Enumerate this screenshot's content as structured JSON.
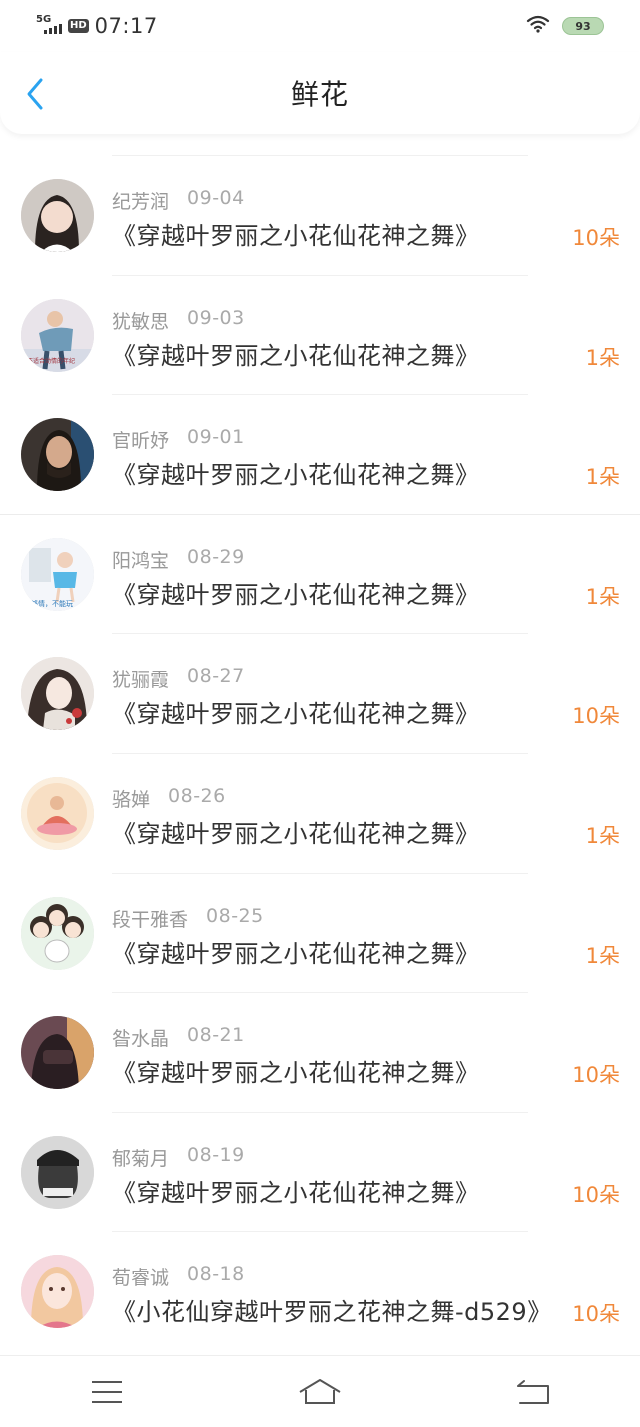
{
  "status_bar": {
    "network": "5G",
    "hd": "HD",
    "time": "07:17",
    "battery": "93"
  },
  "header": {
    "title": "鲜花"
  },
  "colors": {
    "accent_orange": "#f0883a",
    "back_blue": "#2aa3f0"
  },
  "records": [
    {
      "name": "纪芳润",
      "date": "09-04",
      "book": "《穿越叶罗丽之小花仙花神之舞》",
      "count": "10朵"
    },
    {
      "name": "犹敏思",
      "date": "09-03",
      "book": "《穿越叶罗丽之小花仙花神之舞》",
      "count": "1朵"
    },
    {
      "name": "官昕妤",
      "date": "09-01",
      "book": "《穿越叶罗丽之小花仙花神之舞》",
      "count": "1朵"
    },
    {
      "name": "阳鸿宝",
      "date": "08-29",
      "book": "《穿越叶罗丽之小花仙花神之舞》",
      "count": "1朵"
    },
    {
      "name": "犹骊霞",
      "date": "08-27",
      "book": "《穿越叶罗丽之小花仙花神之舞》",
      "count": "10朵"
    },
    {
      "name": "骆婵",
      "date": "08-26",
      "book": "《穿越叶罗丽之小花仙花神之舞》",
      "count": "1朵"
    },
    {
      "name": "段干雅香",
      "date": "08-25",
      "book": "《穿越叶罗丽之小花仙花神之舞》",
      "count": "1朵"
    },
    {
      "name": "昝水晶",
      "date": "08-21",
      "book": "《穿越叶罗丽之小花仙花神之舞》",
      "count": "10朵"
    },
    {
      "name": "郁菊月",
      "date": "08-19",
      "book": "《穿越叶罗丽之小花仙花神之舞》",
      "count": "10朵"
    },
    {
      "name": "荀睿诚",
      "date": "08-18",
      "book": "《小花仙穿越叶罗丽之花神之舞-d529》",
      "count": "10朵"
    }
  ],
  "nav": {
    "menu_icon": "menu-icon",
    "home_icon": "home-icon",
    "back_icon": "return-icon"
  }
}
